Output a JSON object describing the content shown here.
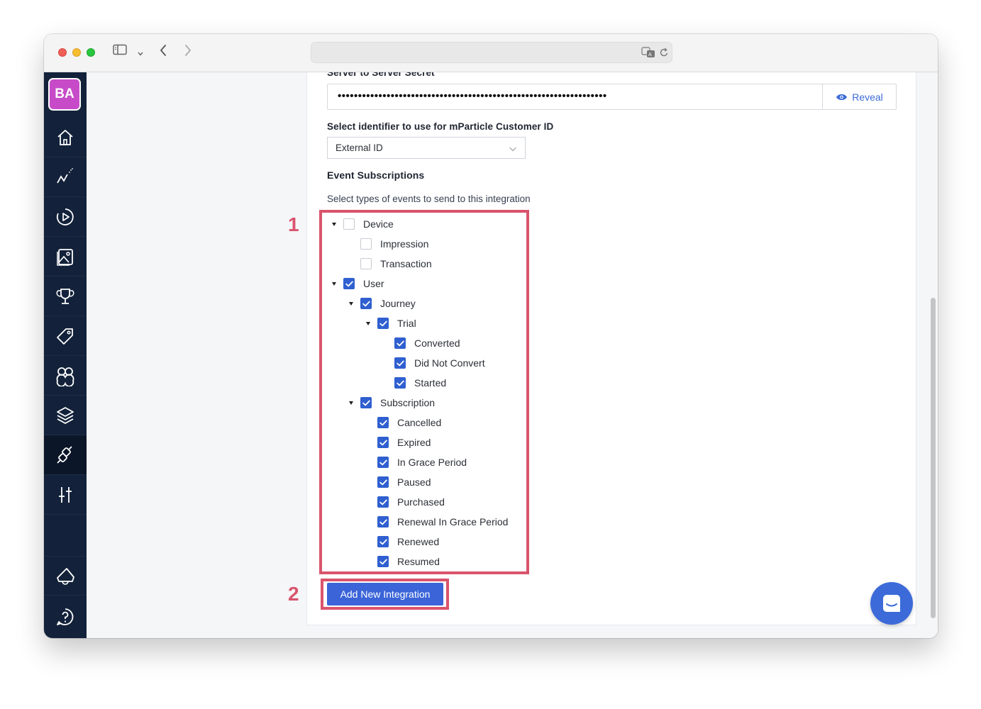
{
  "browser": {
    "sidebar_icon": "sidebar-toggle-icon",
    "back_icon": "chevron-left-icon",
    "forward_icon": "chevron-right-icon",
    "translate_icon": "translate-icon",
    "reload_icon": "reload-icon"
  },
  "sidebar": {
    "avatar_initials": "BA",
    "items": [
      {
        "name": "home",
        "icon": "home-icon"
      },
      {
        "name": "charts",
        "icon": "chart-line-icon"
      },
      {
        "name": "experiments",
        "icon": "play-cycle-icon"
      },
      {
        "name": "paywalls",
        "icon": "image-gallery-icon"
      },
      {
        "name": "achievements",
        "icon": "trophy-icon"
      },
      {
        "name": "products",
        "icon": "price-tag-icon"
      },
      {
        "name": "customers",
        "icon": "users-icon"
      },
      {
        "name": "layers",
        "icon": "layers-icon"
      },
      {
        "name": "integrations",
        "icon": "plug-icon",
        "active": true
      },
      {
        "name": "settings",
        "icon": "sliders-icon"
      },
      {
        "name": "announcements",
        "icon": "megaphone-icon"
      },
      {
        "name": "help",
        "icon": "help-icon"
      }
    ]
  },
  "form": {
    "secret_label": "Server to Server Secret",
    "secret_value": "••••••••••••••••••••••••••••••••••••••••••••••••••••••••••••••••••",
    "reveal_label": "Reveal",
    "identifier_label": "Select identifier to use for mParticle Customer ID",
    "identifier_value": "External ID",
    "subscriptions_title": "Event Subscriptions",
    "subscriptions_desc": "Select types of events to send to this integration",
    "add_button": "Add New Integration"
  },
  "tree": [
    {
      "label": "Device",
      "checked": false,
      "expanded": true,
      "level": 0
    },
    {
      "label": "Impression",
      "checked": false,
      "level": 1
    },
    {
      "label": "Transaction",
      "checked": false,
      "level": 1
    },
    {
      "label": "User",
      "checked": true,
      "expanded": true,
      "level": 0
    },
    {
      "label": "Journey",
      "checked": true,
      "expanded": true,
      "level": 1
    },
    {
      "label": "Trial",
      "checked": true,
      "expanded": true,
      "level": 2
    },
    {
      "label": "Converted",
      "checked": true,
      "level": 3
    },
    {
      "label": "Did Not Convert",
      "checked": true,
      "level": 3
    },
    {
      "label": "Started",
      "checked": true,
      "level": 3
    },
    {
      "label": "Subscription",
      "checked": true,
      "expanded": true,
      "level": 1
    },
    {
      "label": "Cancelled",
      "checked": true,
      "level": 2
    },
    {
      "label": "Expired",
      "checked": true,
      "level": 2
    },
    {
      "label": "In Grace Period",
      "checked": true,
      "level": 2
    },
    {
      "label": "Paused",
      "checked": true,
      "level": 2
    },
    {
      "label": "Purchased",
      "checked": true,
      "level": 2
    },
    {
      "label": "Renewal In Grace Period",
      "checked": true,
      "level": 2
    },
    {
      "label": "Renewed",
      "checked": true,
      "level": 2
    },
    {
      "label": "Resumed",
      "checked": true,
      "level": 2
    }
  ],
  "annotations": {
    "first": "1",
    "second": "2",
    "color": "#d9546c"
  },
  "colors": {
    "sidebar": "#13223a",
    "accent": "#3a64d8",
    "avatar": "#c74bc9"
  }
}
